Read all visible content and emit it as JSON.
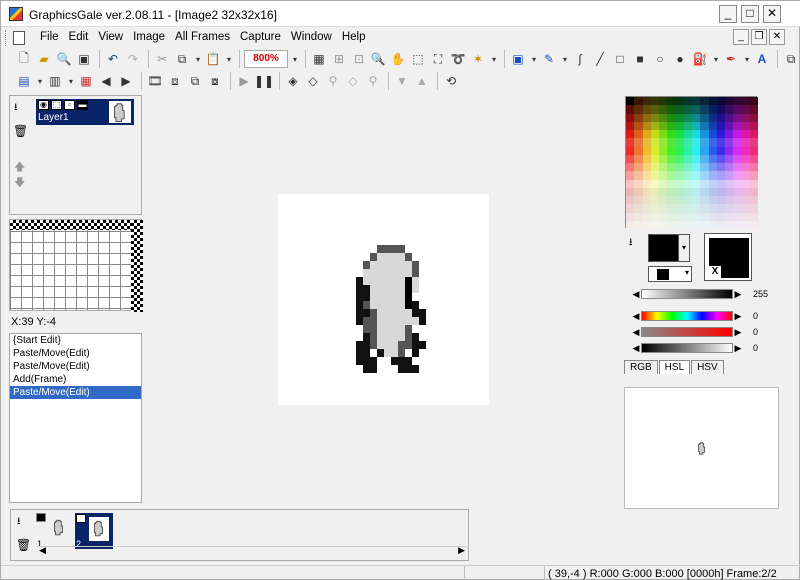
{
  "window": {
    "title": "GraphicsGale ver.2.08.11 - [Image2 32x32x16]",
    "min_label": "_",
    "max_label": "□",
    "close_label": "✕"
  },
  "menu": {
    "items": [
      "File",
      "Edit",
      "View",
      "Image",
      "All Frames",
      "Capture",
      "Window",
      "Help"
    ],
    "mdi_min": "_",
    "mdi_restore": "❐",
    "mdi_close": "✕"
  },
  "toolbar": {
    "zoom": "800%",
    "overflow": "»"
  },
  "layers": {
    "name": "Layer1"
  },
  "coords": {
    "text": "X:39 Y:-4"
  },
  "history": {
    "items": [
      "{Start Edit}",
      "Paste/Move(Edit)",
      "Paste/Move(Edit)",
      "Add(Frame)",
      "Paste/Move(Edit)"
    ],
    "selected_index": 4
  },
  "color": {
    "bg_marker": "X",
    "sliders": [
      {
        "name": "alpha",
        "value": "255"
      },
      {
        "name": "hue",
        "value": "0"
      },
      {
        "name": "saturation",
        "value": "0"
      },
      {
        "name": "lightness",
        "value": "0"
      }
    ],
    "tabs": [
      "RGB",
      "HSL",
      "HSV"
    ],
    "active_tab": "HSL"
  },
  "frames": {
    "items": [
      {
        "num": "1"
      },
      {
        "num": "2"
      }
    ]
  },
  "status": {
    "text": "( 39,-4 ) R:000 G:000 B:000  [0000h]  Frame:2/2"
  }
}
